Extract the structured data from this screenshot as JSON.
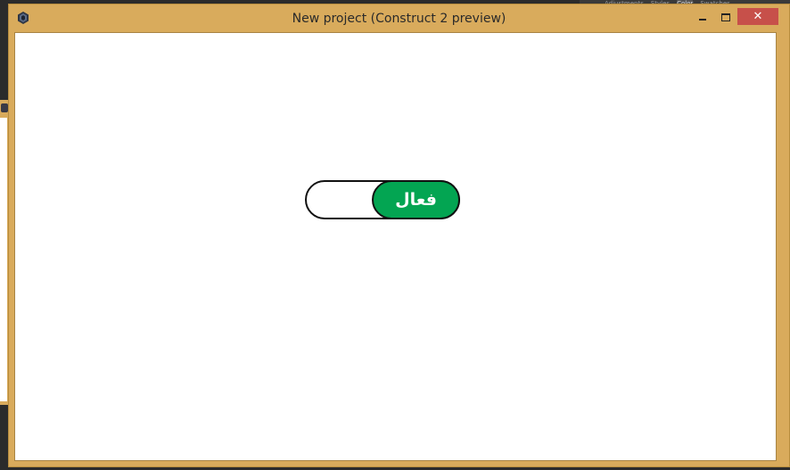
{
  "window": {
    "title": "New project (Construct 2 preview)",
    "close_glyph": "✕",
    "icon": "construct-app-icon"
  },
  "background_panel": {
    "tabs": [
      "Adjustments",
      "Styles",
      "Color",
      "Swatches"
    ]
  },
  "toggle": {
    "label": "فعال",
    "state": "on",
    "on_color": "#03a552"
  },
  "colors": {
    "window_frame": "#d9ab5c",
    "close_button": "#c7504a"
  }
}
